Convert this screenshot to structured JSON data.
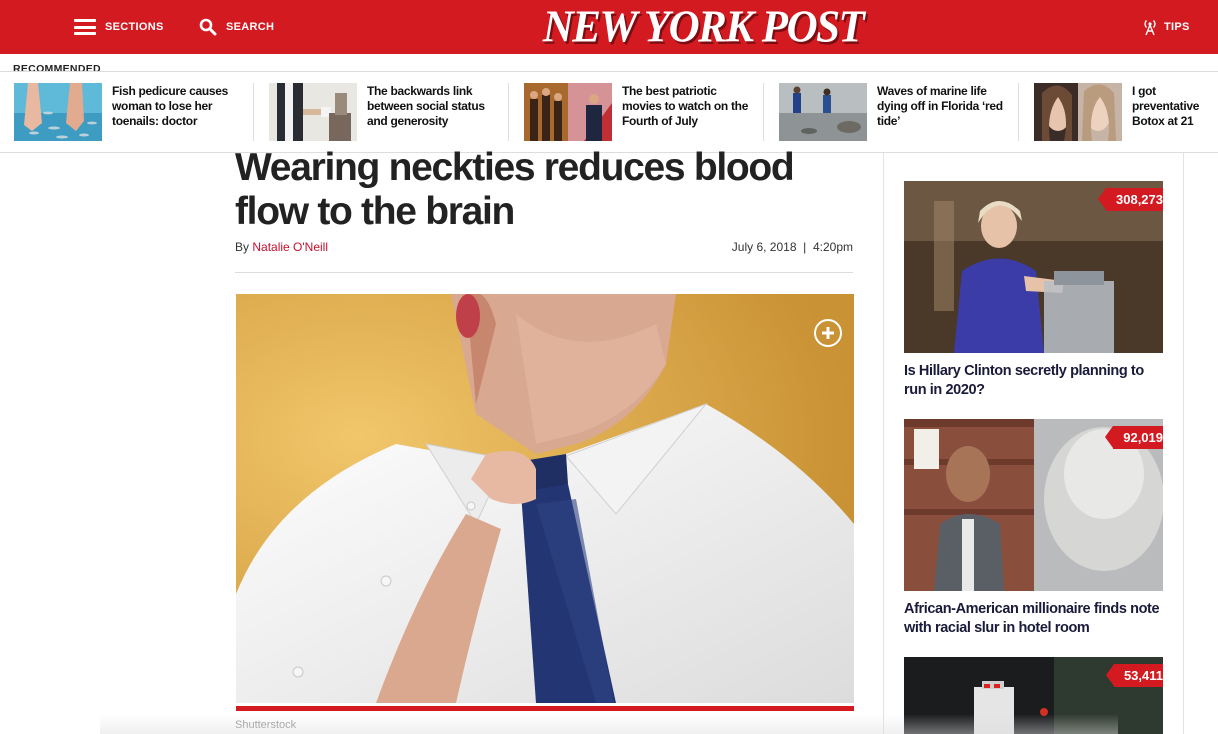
{
  "header": {
    "sections_label": "SECTIONS",
    "search_label": "SEARCH",
    "logo_text": "NEW YORK POST",
    "tips_label": "TIPS"
  },
  "recommended": {
    "label": "RECOMMENDED",
    "items": [
      {
        "title": "Fish pedicure causes woman to lose her toenails: doctor"
      },
      {
        "title": "The backwards link between social status and generosity"
      },
      {
        "title": "The best patriotic movies to watch on the Fourth of July"
      },
      {
        "title": "Waves of marine life dying off in Florida ‘red tide’"
      },
      {
        "title": "I got preventative Botox at 21"
      }
    ]
  },
  "article": {
    "headline": "Wearing neckties reduces blood flow to the brain",
    "by_prefix": "By",
    "author": "Natalie O'Neill",
    "date": "July 6, 2018",
    "date_sep": "|",
    "time": "4:20pm",
    "image_credit": "Shutterstock",
    "accent_color": "#d31a21"
  },
  "sidebar": {
    "cards": [
      {
        "views": "308,273",
        "title": "Is Hillary Clinton secretly planning to run in 2020?"
      },
      {
        "views": "92,019",
        "title": "African-American millionaire finds note with racial slur in hotel room"
      },
      {
        "views": "53,411",
        "title": ""
      }
    ]
  },
  "icons": [
    "hamburger-icon",
    "search-icon",
    "tips-antenna-icon",
    "expand-plus-icon"
  ]
}
